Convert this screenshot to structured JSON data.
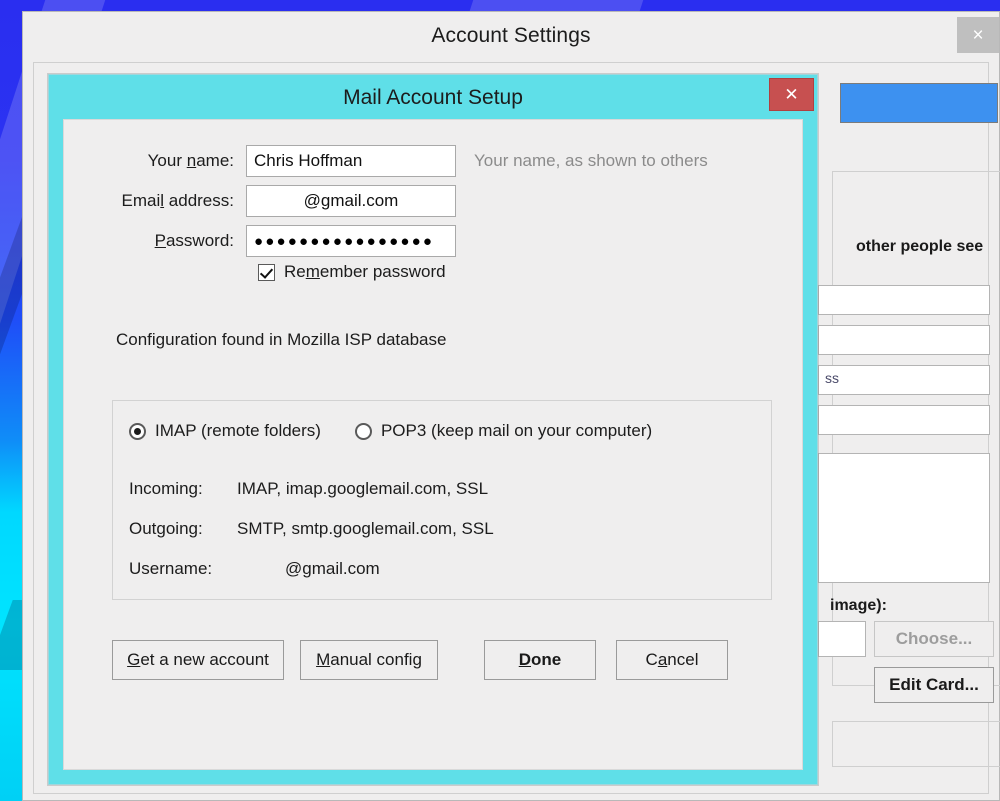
{
  "background_window": {
    "title": "Account Settings",
    "close_label": "×",
    "right_panel": {
      "group_label": "other people see",
      "address_field_text": "ss",
      "photo_label": "image):",
      "choose_button": "Choose...",
      "edit_card_button": "Edit Card..."
    }
  },
  "dialog": {
    "title": "Mail Account Setup",
    "close_label": "✕",
    "fields": [
      {
        "label_pre": "Your ",
        "label_accel": "n",
        "label_post": "ame:",
        "value": "Chris Hoffman",
        "hint": "Your name, as shown to others",
        "name": "your-name"
      },
      {
        "label_pre": "Emai",
        "label_accel": "l",
        "label_post": " address:",
        "value": "@gmail.com",
        "hint": "",
        "name": "email-address"
      },
      {
        "label_pre": "",
        "label_accel": "P",
        "label_post": "assword:",
        "value": "●●●●●●●●●●●●●●●●",
        "hint": "",
        "name": "password"
      }
    ],
    "remember_password": {
      "pre": "Re",
      "accel": "m",
      "post": "ember password",
      "checked": true
    },
    "status_text": "Configuration found in Mozilla ISP database",
    "protocol_options": [
      {
        "label": "IMAP (remote folders)",
        "selected": true
      },
      {
        "label": "POP3 (keep mail on your computer)",
        "selected": false
      }
    ],
    "server_info": [
      {
        "key": "Incoming:",
        "value": "IMAP, imap.googlemail.com, SSL"
      },
      {
        "key": "Outgoing:",
        "value": "SMTP, smtp.googlemail.com, SSL"
      },
      {
        "key": "Username:",
        "value": "@gmail.com"
      }
    ],
    "buttons": [
      {
        "pre": "",
        "accel": "G",
        "post": "et a new account",
        "name": "get-a-new-account",
        "default": false
      },
      {
        "pre": "",
        "accel": "M",
        "post": "anual config",
        "name": "manual-config",
        "default": false
      },
      {
        "pre": "",
        "accel": "D",
        "post": "one",
        "name": "done",
        "default": true
      },
      {
        "pre": "C",
        "accel": "a",
        "post": "ncel",
        "name": "cancel",
        "default": false
      }
    ]
  },
  "colors": {
    "dialog_accent": "#5fdfe8",
    "close_red": "#c75050",
    "window_bg": "#efeeee",
    "highlight_blue": "#3d91f0"
  }
}
